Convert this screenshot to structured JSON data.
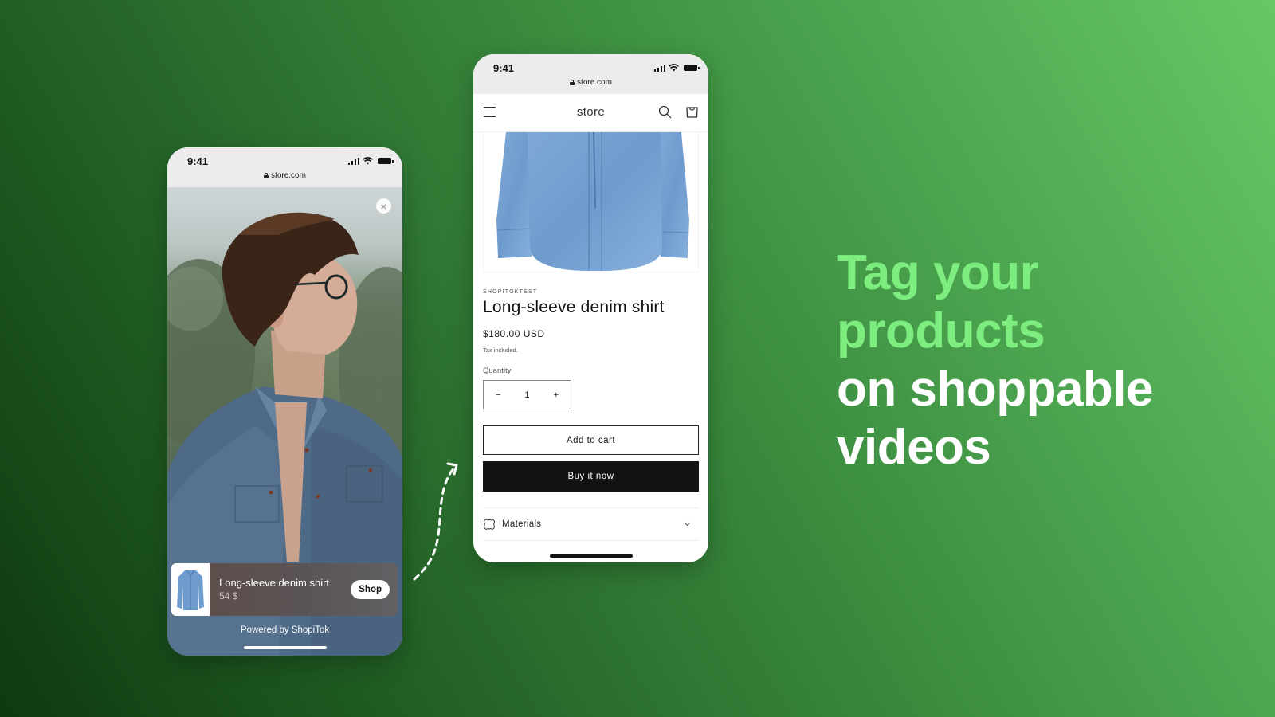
{
  "colors": {
    "background_dark": "#0e3a10",
    "background_light": "#66c865",
    "headline_accent": "#7ded80",
    "headline_white": "#ffffff",
    "buy_button": "#121212"
  },
  "left_phone": {
    "status_time": "9:41",
    "url": "store.com",
    "close_icon": "close-icon",
    "product_card": {
      "title": "Long-sleeve denim shirt",
      "price": "54 $",
      "shop_label": "Shop"
    },
    "powered_by": "Powered by ShopiTok"
  },
  "right_phone": {
    "status_time": "9:41",
    "url": "store.com",
    "header": {
      "menu_icon": "hamburger-icon",
      "store_name": "store",
      "search_icon": "search-icon",
      "cart_icon": "cart-icon"
    },
    "product": {
      "vendor": "SHOPITOKTEST",
      "title": "Long-sleeve denim shirt",
      "price": "$180.00 USD",
      "tax_note": "Tax included.",
      "quantity_label": "Quantity",
      "quantity_value": "1",
      "decrement": "−",
      "increment": "+",
      "add_to_cart": "Add to cart",
      "buy_now": "Buy it now",
      "accordion": {
        "label": "Materials",
        "icon": "leather-icon"
      }
    }
  },
  "headline": {
    "line1": "Tag your",
    "line2": "products",
    "line3": "on shoppable",
    "line4": "videos"
  }
}
